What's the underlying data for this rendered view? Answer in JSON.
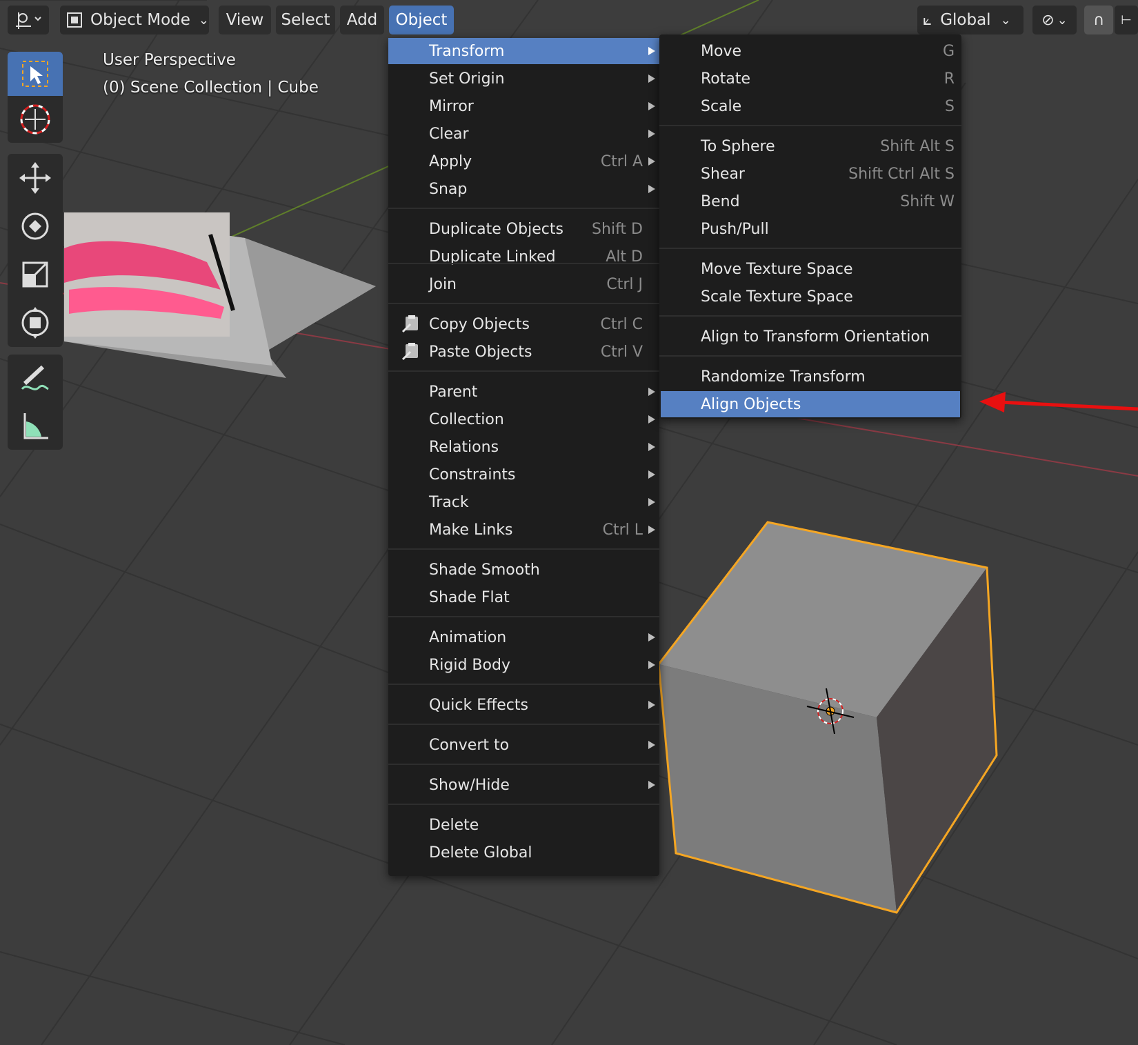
{
  "header": {
    "mode_label": "Object Mode",
    "menus": [
      "View",
      "Select",
      "Add",
      "Object"
    ],
    "active_menu": "Object",
    "orientation_label": "Global"
  },
  "viewport": {
    "perspective": "User Perspective",
    "collection": "(0) Scene Collection | Cube"
  },
  "toolbar": {
    "tools": [
      "select-box-icon",
      "cursor-icon",
      "move-icon",
      "rotate-icon",
      "scale-icon",
      "transform-icon",
      "annotate-icon",
      "measure-icon"
    ],
    "active_tool": "select-box-icon"
  },
  "object_menu": {
    "items": [
      {
        "label": "Transform",
        "shortcut": "",
        "submenu": true,
        "highlighted": true
      },
      {
        "label": "Set Origin",
        "shortcut": "",
        "submenu": true
      },
      {
        "label": "Mirror",
        "shortcut": "",
        "submenu": true
      },
      {
        "label": "Clear",
        "shortcut": "",
        "submenu": true
      },
      {
        "label": "Apply",
        "shortcut": "Ctrl A",
        "submenu": true
      },
      {
        "label": "Snap",
        "shortcut": "",
        "submenu": true
      },
      {
        "label": "Duplicate Objects",
        "shortcut": "Shift D",
        "submenu": false
      },
      {
        "label": "Duplicate Linked",
        "shortcut": "Alt D",
        "submenu": false
      },
      {
        "label": "Join",
        "shortcut": "Ctrl J",
        "submenu": false
      },
      {
        "label": "Copy Objects",
        "shortcut": "Ctrl C",
        "submenu": false,
        "icon": "copy-icon"
      },
      {
        "label": "Paste Objects",
        "shortcut": "Ctrl V",
        "submenu": false,
        "icon": "paste-icon"
      },
      {
        "label": "Parent",
        "shortcut": "",
        "submenu": true
      },
      {
        "label": "Collection",
        "shortcut": "",
        "submenu": true
      },
      {
        "label": "Relations",
        "shortcut": "",
        "submenu": true
      },
      {
        "label": "Constraints",
        "shortcut": "",
        "submenu": true
      },
      {
        "label": "Track",
        "shortcut": "",
        "submenu": true
      },
      {
        "label": "Make Links",
        "shortcut": "Ctrl L",
        "submenu": true
      },
      {
        "label": "Shade Smooth",
        "shortcut": "",
        "submenu": false
      },
      {
        "label": "Shade Flat",
        "shortcut": "",
        "submenu": false
      },
      {
        "label": "Animation",
        "shortcut": "",
        "submenu": true
      },
      {
        "label": "Rigid Body",
        "shortcut": "",
        "submenu": true
      },
      {
        "label": "Quick Effects",
        "shortcut": "",
        "submenu": true
      },
      {
        "label": "Convert to",
        "shortcut": "",
        "submenu": true
      },
      {
        "label": "Show/Hide",
        "shortcut": "",
        "submenu": true
      },
      {
        "label": "Delete",
        "shortcut": "",
        "submenu": false
      },
      {
        "label": "Delete Global",
        "shortcut": "",
        "submenu": false
      }
    ]
  },
  "transform_submenu": {
    "items": [
      {
        "label": "Move",
        "shortcut": "G"
      },
      {
        "label": "Rotate",
        "shortcut": "R"
      },
      {
        "label": "Scale",
        "shortcut": "S"
      },
      {
        "label": "To Sphere",
        "shortcut": "Shift Alt S"
      },
      {
        "label": "Shear",
        "shortcut": "Shift Ctrl Alt S"
      },
      {
        "label": "Bend",
        "shortcut": "Shift W"
      },
      {
        "label": "Push/Pull",
        "shortcut": ""
      },
      {
        "label": "Move Texture Space",
        "shortcut": ""
      },
      {
        "label": "Scale Texture Space",
        "shortcut": ""
      },
      {
        "label": "Align to Transform Orientation",
        "shortcut": ""
      },
      {
        "label": "Randomize Transform",
        "shortcut": ""
      },
      {
        "label": "Align Objects",
        "shortcut": "",
        "highlighted": true
      }
    ]
  },
  "colors": {
    "accent": "#4772b3",
    "highlight": "#5680c2",
    "selection_outline": "#f5a623",
    "annotation_arrow": "#e81010"
  }
}
